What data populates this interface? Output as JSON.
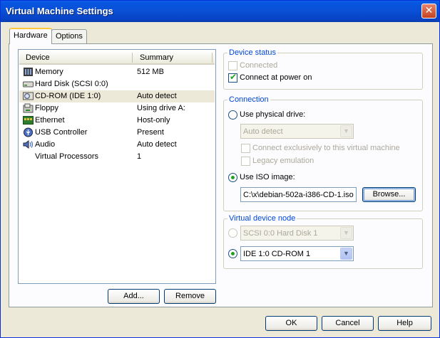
{
  "window": {
    "title": "Virtual Machine Settings"
  },
  "tabs": [
    {
      "label": "Hardware"
    },
    {
      "label": "Options"
    }
  ],
  "device_list": {
    "columns": [
      "Device",
      "Summary"
    ],
    "rows": [
      {
        "device": "Memory",
        "summary": "512 MB",
        "icon": "memory-icon"
      },
      {
        "device": "Hard Disk (SCSI 0:0)",
        "summary": "",
        "icon": "hard-disk-icon"
      },
      {
        "device": "CD-ROM (IDE 1:0)",
        "summary": "Auto detect",
        "icon": "cdrom-icon",
        "selected": true
      },
      {
        "device": "Floppy",
        "summary": "Using drive A:",
        "icon": "floppy-icon"
      },
      {
        "device": "Ethernet",
        "summary": "Host-only",
        "icon": "ethernet-icon"
      },
      {
        "device": "USB Controller",
        "summary": "Present",
        "icon": "usb-icon"
      },
      {
        "device": "Audio",
        "summary": "Auto detect",
        "icon": "audio-icon"
      },
      {
        "device": "Virtual Processors",
        "summary": "1",
        "icon": "processor-icon"
      }
    ],
    "add_label": "Add...",
    "remove_label": "Remove"
  },
  "device_status": {
    "title": "Device status",
    "connected_label": "Connected",
    "connected": false,
    "connect_power_label": "Connect at power on",
    "connect_power": true
  },
  "connection": {
    "title": "Connection",
    "physical_label": "Use physical drive:",
    "physical_value": "Auto detect",
    "exclusive_label": "Connect exclusively to this virtual machine",
    "legacy_label": "Legacy emulation",
    "iso_label": "Use ISO image:",
    "iso_value": "C:\\x\\debian-502a-i386-CD-1.iso",
    "browse_label": "Browse..."
  },
  "virtual_device_node": {
    "title": "Virtual device node",
    "scsi_value": "SCSI 0:0   Hard Disk 1",
    "ide_value": "IDE 1:0   CD-ROM 1"
  },
  "footer": {
    "ok_label": "OK",
    "cancel_label": "Cancel",
    "help_label": "Help"
  },
  "colors": {
    "title_bar": "#0a4fd6",
    "group_label": "#0046d5",
    "check": "#21a121"
  }
}
